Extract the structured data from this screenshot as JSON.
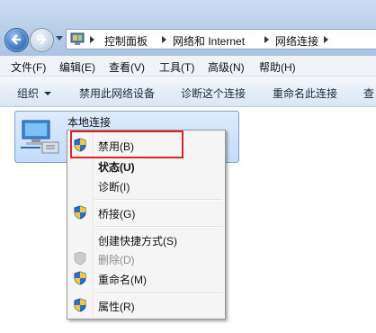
{
  "address": {
    "crumbs": [
      "控制面板",
      "网络和 Internet",
      "网络连接"
    ]
  },
  "menubar": {
    "items": [
      "文件(F)",
      "编辑(E)",
      "查看(V)",
      "工具(T)",
      "高级(N)",
      "帮助(H)"
    ]
  },
  "commandbar": {
    "organize": "组织",
    "disable": "禁用此网络设备",
    "diagnose": "诊断这个连接",
    "rename": "重命名此连接",
    "more": "查"
  },
  "connection": {
    "name": "本地连接"
  },
  "context_menu": {
    "items": [
      "禁用(B)",
      "状态(U)",
      "诊断(I)",
      "桥接(G)",
      "创建快捷方式(S)",
      "删除(D)",
      "重命名(M)",
      "属性(R)"
    ]
  },
  "colors": {
    "highlight_border": "#d6262b",
    "selection": "#c2dcfa"
  }
}
